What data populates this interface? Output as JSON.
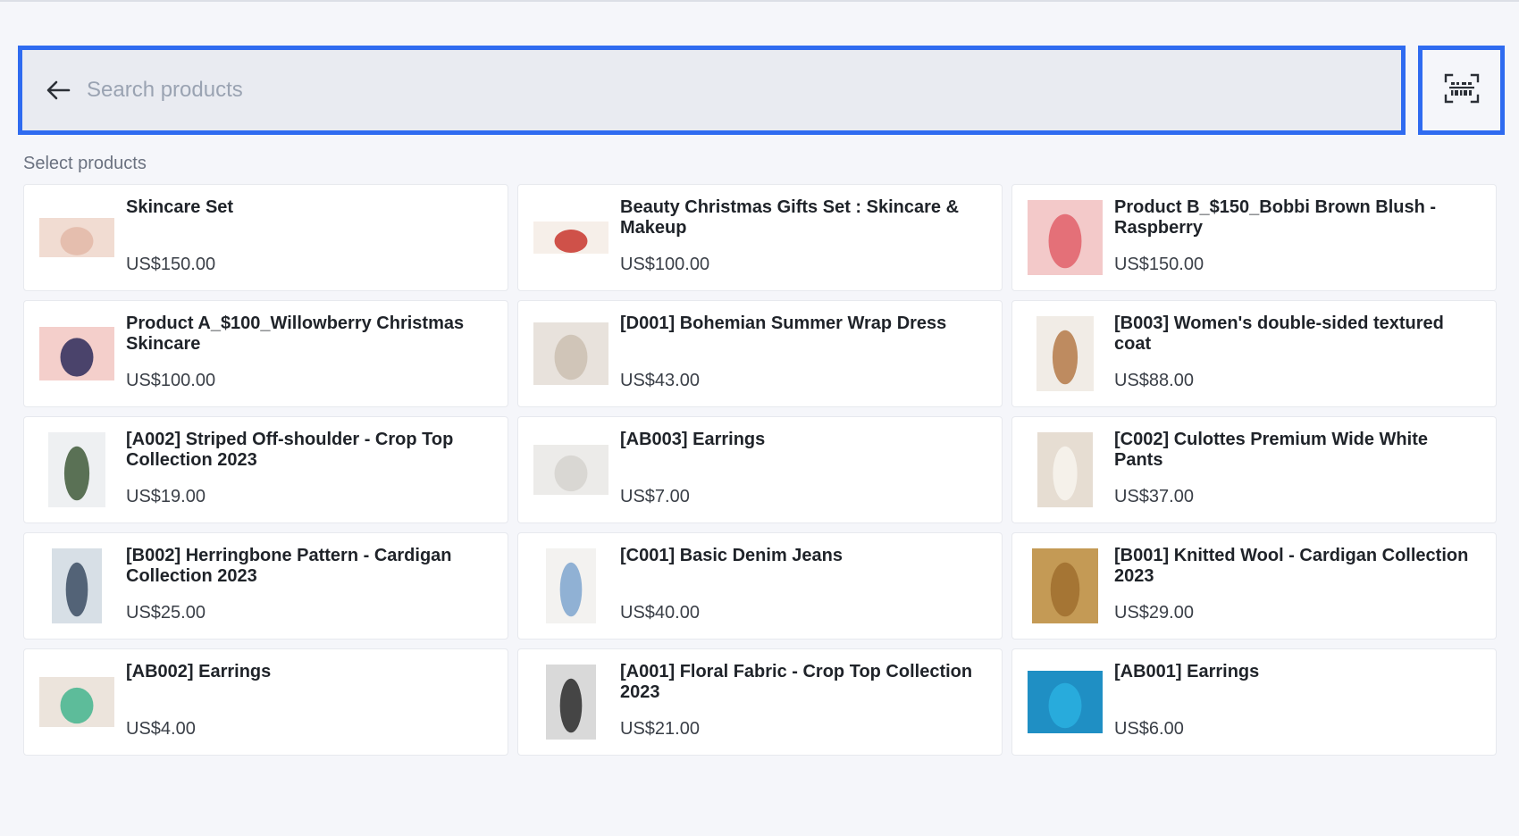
{
  "search": {
    "placeholder": "Search products",
    "value": ""
  },
  "section_title": "Select products",
  "icons": {
    "back": "arrow-left-icon",
    "scan": "barcode-scan-icon"
  },
  "accent_color": "#2f6bf0",
  "products": [
    {
      "title": "Skincare Set",
      "price": "US$150.00",
      "thumb_colors": [
        "#f1dcd2",
        "#e3b9a8"
      ]
    },
    {
      "title": "Beauty Christmas Gifts Set : Skincare & Makeup",
      "price": "US$100.00",
      "thumb_colors": [
        "#f6efe9",
        "#c8352d"
      ]
    },
    {
      "title": "Product B_$150_Bobbi Brown Blush - Raspberry",
      "price": "US$150.00",
      "thumb_colors": [
        "#f3c9c9",
        "#e0606a"
      ]
    },
    {
      "title": "Product A_$100_Willowberry Christmas Skincare",
      "price": "US$100.00",
      "thumb_colors": [
        "#f4cfcb",
        "#2b2a5a"
      ]
    },
    {
      "title": "[D001] Bohemian Summer Wrap Dress",
      "price": "US$43.00",
      "thumb_colors": [
        "#e8e2dc",
        "#cbbfb2"
      ]
    },
    {
      "title": "[B003] Women's double-sided textured coat",
      "price": "US$88.00",
      "thumb_colors": [
        "#f1ece6",
        "#b57a48"
      ]
    },
    {
      "title": "[A002] Striped Off-shoulder - Crop Top Collection 2023",
      "price": "US$19.00",
      "thumb_colors": [
        "#eef0f2",
        "#3f5a3a"
      ]
    },
    {
      "title": "[AB003] Earrings",
      "price": "US$7.00",
      "thumb_colors": [
        "#ecebe9",
        "#d6d3cf"
      ]
    },
    {
      "title": "[C002] Culottes Premium Wide White Pants",
      "price": "US$37.00",
      "thumb_colors": [
        "#e6ddd2",
        "#f7f4ef"
      ]
    },
    {
      "title": "[B002] Herringbone Pattern - Cardigan Collection 2023",
      "price": "US$25.00",
      "thumb_colors": [
        "#d7dfe6",
        "#3c4d63"
      ]
    },
    {
      "title": "[C001] Basic Denim Jeans",
      "price": "US$40.00",
      "thumb_colors": [
        "#f3f2f0",
        "#7ea6cf"
      ]
    },
    {
      "title": "[B001] Knitted Wool - Cardigan Collection 2023",
      "price": "US$29.00",
      "thumb_colors": [
        "#c49a55",
        "#a06e2f"
      ]
    },
    {
      "title": "[AB002] Earrings",
      "price": "US$4.00",
      "thumb_colors": [
        "#ece4dc",
        "#44b58e"
      ]
    },
    {
      "title": "[A001] Floral Fabric - Crop Top Collection 2023",
      "price": "US$21.00",
      "thumb_colors": [
        "#d9d9d9",
        "#2a2a2a"
      ]
    },
    {
      "title": "[AB001] Earrings",
      "price": "US$6.00",
      "thumb_colors": [
        "#1f8fc4",
        "#2ab0e0"
      ]
    }
  ]
}
